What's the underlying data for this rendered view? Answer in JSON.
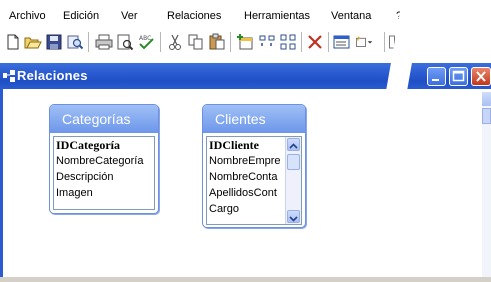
{
  "menu": {
    "items": [
      {
        "label": "Archivo"
      },
      {
        "label": "Edición"
      },
      {
        "label": "Ver"
      },
      {
        "label": "Relaciones"
      },
      {
        "label": "Herramientas"
      },
      {
        "label": "Ventana"
      },
      {
        "label": "?"
      }
    ]
  },
  "toolbar": {
    "icons": [
      "new-icon",
      "open-icon",
      "save-icon",
      "search-icon",
      "print-icon",
      "print-preview-icon",
      "spelling-icon",
      "cut-icon",
      "copy-icon",
      "paste-icon",
      "show-table-icon",
      "show-direct-icon",
      "show-all-icon",
      "delete-icon",
      "database-window-icon",
      "new-object-icon"
    ]
  },
  "window": {
    "title": "Relaciones",
    "accent": "#2a5bd0"
  },
  "tables": [
    {
      "name": "Categorías",
      "fields": [
        "IDCategoría",
        "NombreCategoría",
        "Descripción",
        "Imagen"
      ]
    },
    {
      "name": "Clientes",
      "fields": [
        "IDCliente",
        "NombreEmpre",
        "NombreConta",
        "ApellidosCont",
        "Cargo"
      ]
    }
  ]
}
